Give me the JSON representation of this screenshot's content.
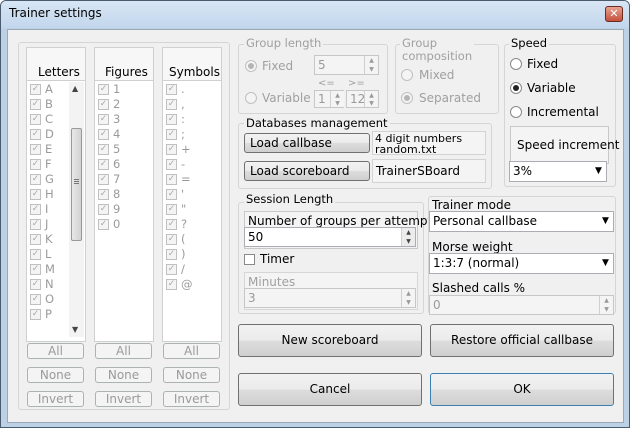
{
  "window": {
    "title": "Trainer settings"
  },
  "lists": {
    "letters": {
      "header": "Letters",
      "items": [
        "A",
        "B",
        "C",
        "D",
        "E",
        "F",
        "G",
        "H",
        "I",
        "J",
        "K",
        "L",
        "M",
        "N",
        "O",
        "P"
      ]
    },
    "figures": {
      "header": "Figures",
      "items": [
        "1",
        "2",
        "3",
        "4",
        "5",
        "6",
        "7",
        "8",
        "9",
        "0"
      ]
    },
    "symbols": {
      "header": "Symbols",
      "items": [
        ".",
        ",",
        ":",
        ";",
        "+",
        "-",
        "=",
        "'",
        "\"",
        "?",
        "(",
        ")",
        "/",
        "@"
      ]
    },
    "buttons": {
      "all": "All",
      "none": "None",
      "invert": "Invert"
    }
  },
  "group_length": {
    "title": "Group length",
    "fixed_label": "Fixed",
    "fixed_value": "5",
    "variable_label": "Variable",
    "min_label": "<=",
    "max_label": ">=",
    "min_value": "1",
    "max_value": "12"
  },
  "group_composition": {
    "title_line1": "Group",
    "title_line2": "composition",
    "mixed_label": "Mixed",
    "separated_label": "Separated"
  },
  "speed": {
    "title": "Speed",
    "fixed_label": "Fixed",
    "variable_label": "Variable",
    "incremental_label": "Incremental",
    "increment_button": "Speed increment",
    "increment_value": "3%"
  },
  "databases": {
    "title": "Databases management",
    "load_callbase": "Load callbase",
    "callbase_name": "4 digit numbers random.txt",
    "load_scoreboard": "Load scoreboard",
    "scoreboard_name": "TrainerSBoard"
  },
  "session": {
    "title": "Session Length",
    "groups_label": "Number of groups per attempt",
    "groups_value": "50",
    "timer_label": "Timer",
    "minutes_label": "Minutes",
    "minutes_value": "3"
  },
  "trainer_mode": {
    "label": "Trainer mode",
    "value": "Personal callbase"
  },
  "morse_weight": {
    "label": "Morse weight",
    "value": "1:3:7 (normal)"
  },
  "slashed": {
    "label": "Slashed calls %",
    "value": "0"
  },
  "actions": {
    "new_scoreboard": "New scoreboard",
    "restore": "Restore official callbase",
    "cancel": "Cancel",
    "ok": "OK"
  },
  "icons": {
    "close": "close-icon",
    "check": "check-icon",
    "spin_up": "spin-up-icon",
    "spin_down": "spin-down-icon",
    "dropdown": "chevron-down-icon",
    "scroll_up": "scroll-up-icon",
    "scroll_down": "scroll-down-icon"
  }
}
